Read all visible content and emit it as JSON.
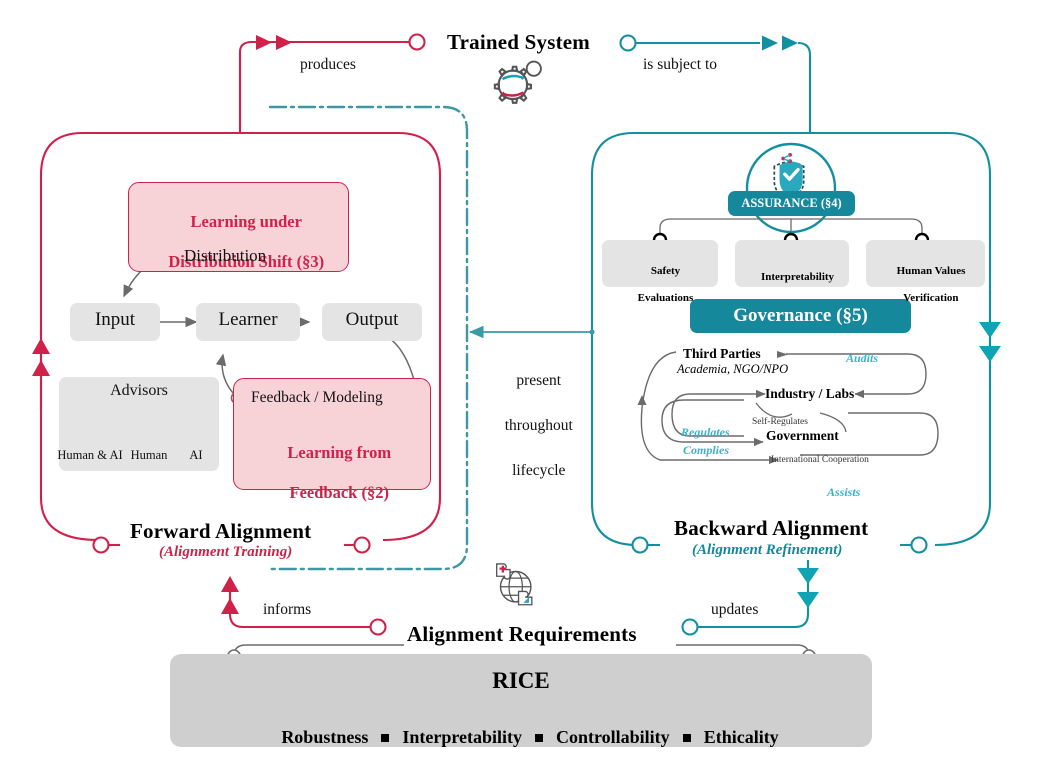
{
  "colors": {
    "red": "#d0214b",
    "teal": "#12909f",
    "teal_light": "#36b6c9",
    "grey_box": "#e4e4e4",
    "pink_fill": "#f7d3d8",
    "rice_box": "#cfcfcf",
    "arrow_grey": "#6b6b6b"
  },
  "top": {
    "trained_system_title": "Trained System",
    "trained_system_icon": "gears-icon",
    "produces_label": "produces",
    "is_subject_to_label": "is subject to"
  },
  "forward": {
    "title": "Forward Alignment",
    "subtitle": "(Alignment Training)",
    "dist_shift_box": {
      "line1": "Learning under",
      "line2": "Distribution Shift (§3)",
      "port_label": "Distribution"
    },
    "pipeline": [
      "Input",
      "Learner",
      "Output"
    ],
    "advisors": {
      "title": "Advisors",
      "items": [
        {
          "label": "Human & AI",
          "icon": "human-and-ai-icon"
        },
        {
          "label": "Human",
          "icon": "human-icon"
        },
        {
          "label": "AI",
          "icon": "ai-brain-icon"
        }
      ]
    },
    "feedback_box": {
      "port_label": "Feedback / Modeling",
      "line1": "Learning from",
      "line2": "Feedback (§2)"
    }
  },
  "middle": {
    "present_throughout_lifecycle": [
      "present",
      "throughout",
      "lifecycle"
    ]
  },
  "backward": {
    "title": "Backward Alignment",
    "subtitle": "(Alignment Refinement)",
    "assurance": {
      "badge_label": "ASSURANCE (§4)",
      "badge_icon": "shield-check-icon",
      "children": [
        [
          "Safety",
          "Evaluations"
        ],
        [
          "Interpretability",
          ""
        ],
        [
          "Human Values",
          "Verification"
        ]
      ]
    },
    "governance": {
      "title": "Governance (§5)",
      "nodes": [
        {
          "name": "Third Parties",
          "sub": "Academia, NGO/NPO"
        },
        {
          "name": "Industry / Labs",
          "sub": ""
        },
        {
          "name": "Government",
          "sub": ""
        }
      ],
      "edge_labels": [
        {
          "text": "Audits",
          "style": "teal"
        },
        {
          "text": "Self-Regulates",
          "style": "grey"
        },
        {
          "text": "Regulates",
          "style": "teal"
        },
        {
          "text": "Complies",
          "style": "teal"
        },
        {
          "text": "International Cooperation",
          "style": "grey"
        },
        {
          "text": "Assists",
          "style": "teal"
        }
      ]
    }
  },
  "bottom": {
    "informs_label": "informs",
    "updates_label": "updates",
    "requirements_title": "Alignment Requirements",
    "requirements_icon": "globe-puzzle-icon",
    "rice": {
      "title": "RICE",
      "items": [
        "Robustness",
        "Interpretability",
        "Controllability",
        "Ethicality"
      ]
    }
  }
}
